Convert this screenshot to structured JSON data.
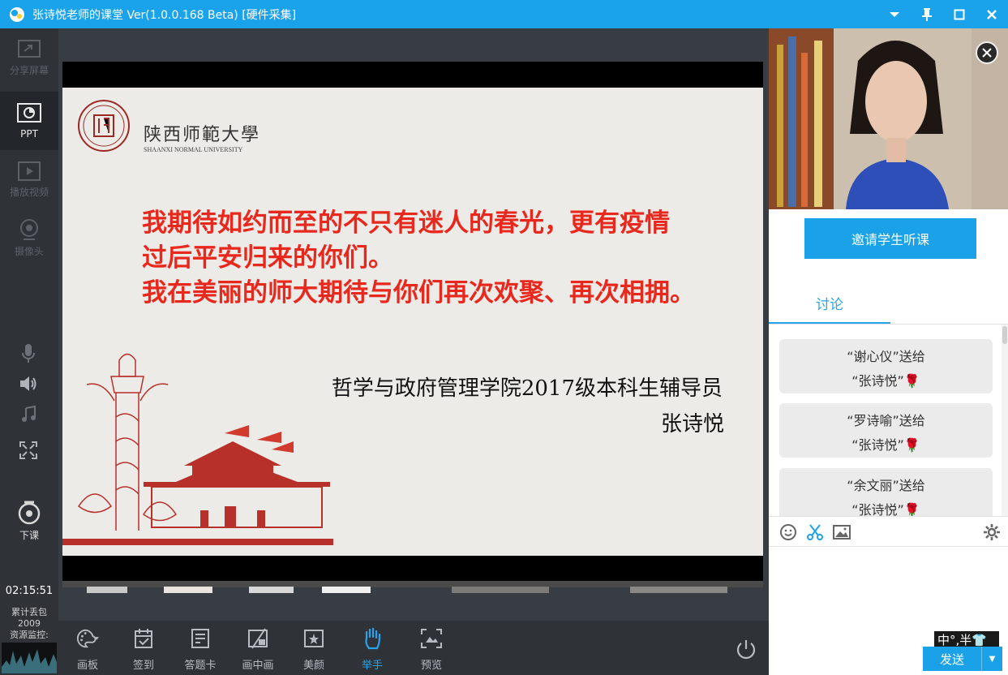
{
  "window": {
    "title": "张诗悦老师的课堂 Ver(1.0.0.168 Beta)  [硬件采集]",
    "controls": [
      "dropdown-icon",
      "pin-icon",
      "maximize-icon",
      "close-icon"
    ]
  },
  "sidebar": {
    "items": [
      {
        "label": "分享屏幕",
        "icon": "share-screen-icon",
        "state": "disabled"
      },
      {
        "label": "PPT",
        "icon": "ppt-icon",
        "state": "active"
      },
      {
        "label": "播放视频",
        "icon": "play-video-icon",
        "state": "disabled"
      },
      {
        "label": "摄像头",
        "icon": "camera-icon",
        "state": "disabled"
      }
    ],
    "audio_icons": [
      "microphone-icon",
      "speaker-icon",
      "music-icon",
      "fullscreen-icon"
    ],
    "end_class": "下课",
    "time": "02:15:51",
    "packet_loss_label": "累计丢包",
    "packet_loss_value": "2009",
    "resource_label": "资源监控:"
  },
  "slide": {
    "university_cn": "陕西师範大學",
    "university_en": "SHAANXI NORMAL UNIVERSITY",
    "quote_lines": [
      "我期待如约而至的不只有迷人的春光，更有疫情",
      "过后平安归来的你们。",
      "我在美丽的师大期待与你们再次欢聚、再次相拥。"
    ],
    "signature_line1": "哲学与政府管理学院2017级本科生辅导员",
    "signature_line2": "张诗悦"
  },
  "toolbar": {
    "tools": [
      {
        "label": "画板",
        "icon": "palette-icon"
      },
      {
        "label": "签到",
        "icon": "checkin-icon"
      },
      {
        "label": "答题卡",
        "icon": "answer-card-icon"
      },
      {
        "label": "画中画",
        "icon": "picture-in-picture-icon"
      },
      {
        "label": "美颜",
        "icon": "beauty-icon"
      },
      {
        "label": "举手",
        "icon": "raise-hand-icon",
        "active": true
      },
      {
        "label": "预览",
        "icon": "preview-icon"
      }
    ]
  },
  "panel": {
    "invite_button": "邀请学生听课",
    "tab_discussion": "讨论",
    "messages": [
      {
        "line1": "“谢心仪”送给",
        "line2": "“张诗悦”🌹"
      },
      {
        "line1": "“罗诗喻”送给",
        "line2": "“张诗悦”🌹"
      },
      {
        "line1": "“余文丽”送给",
        "line2": "“张诗悦”🌹"
      }
    ],
    "ime_indicator": "中°,半👕",
    "send_button": "发送",
    "send_dropdown": "▼"
  },
  "colors": {
    "accent": "#1aa3ea",
    "quote_red": "#e8281c",
    "sidebar_bg": "#2f3237"
  }
}
